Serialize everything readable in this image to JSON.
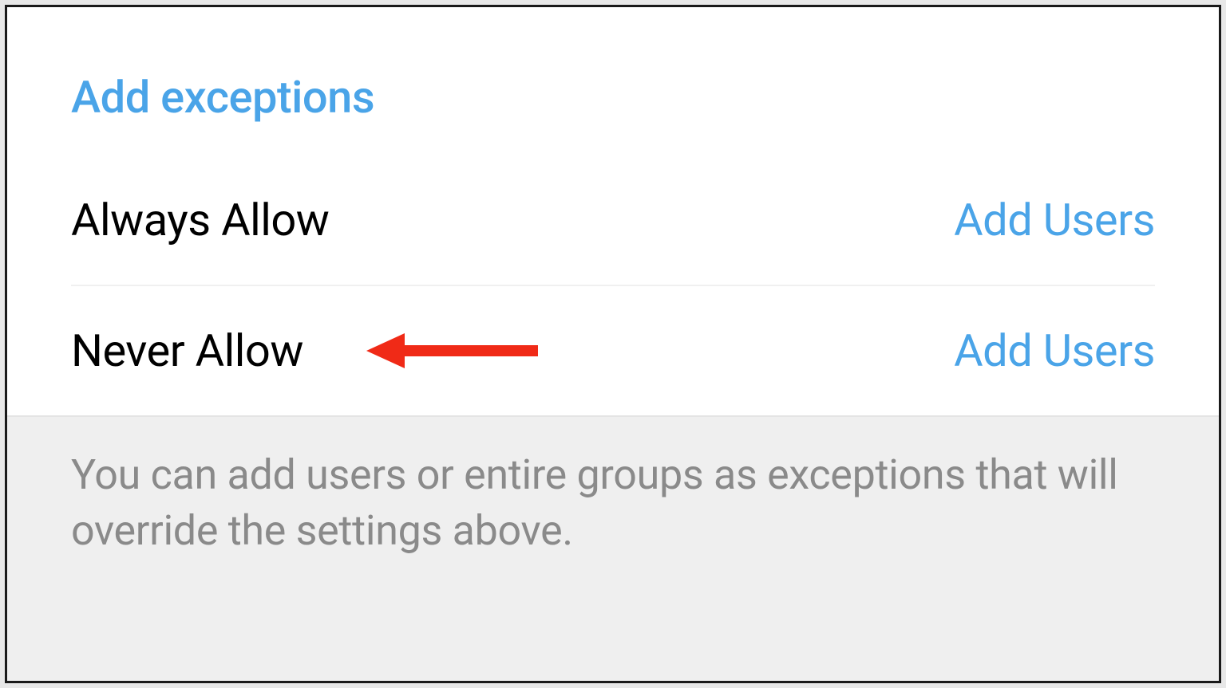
{
  "header": {
    "title": "Add exceptions"
  },
  "rows": {
    "always_allow": {
      "label": "Always Allow",
      "action": "Add Users"
    },
    "never_allow": {
      "label": "Never Allow",
      "action": "Add Users"
    }
  },
  "footer": {
    "text": "You can add users or entire groups as exceptions that will override the settings above."
  },
  "annotation": {
    "type": "arrow",
    "color": "#f02a17",
    "points_to": "never_allow"
  }
}
